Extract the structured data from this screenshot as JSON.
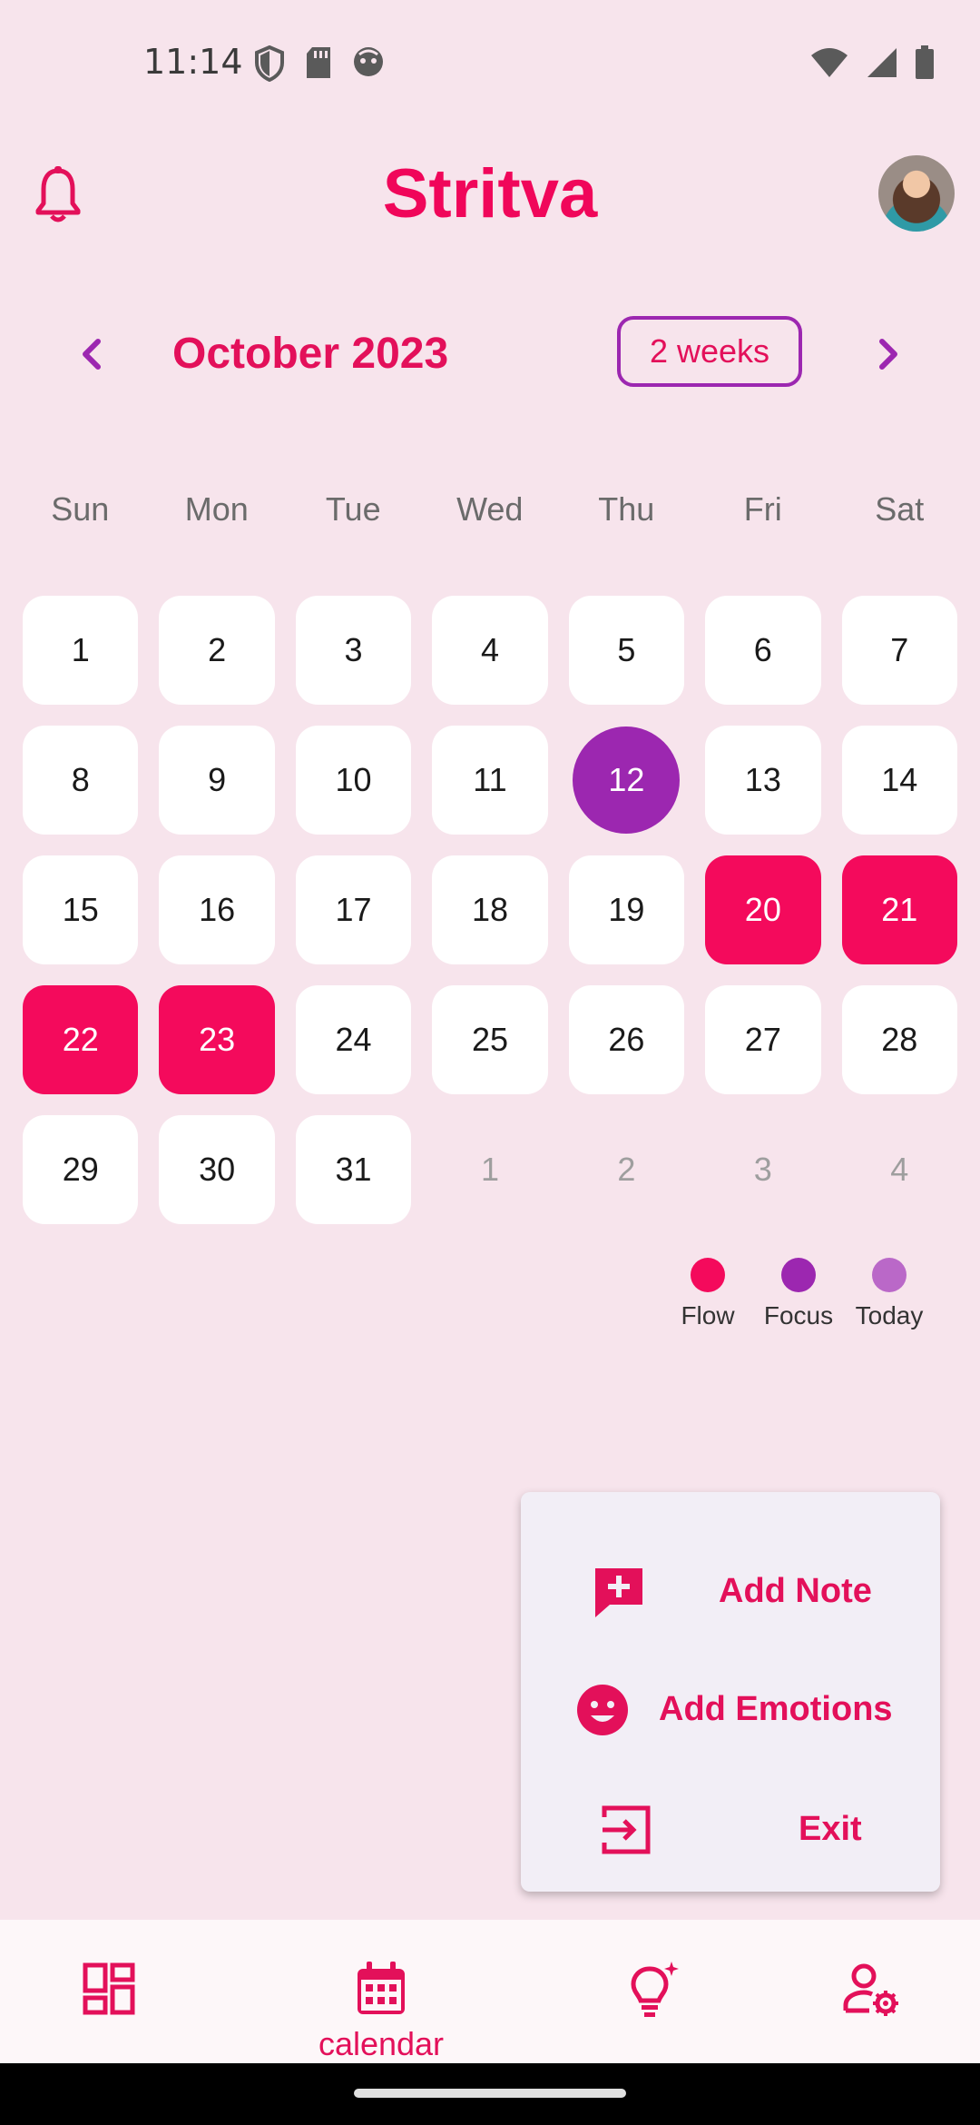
{
  "status_bar": {
    "time": "11:14"
  },
  "app": {
    "title": "Stritva"
  },
  "calendar": {
    "month_label": "October 2023",
    "range_button": "2 weeks",
    "weekdays": [
      "Sun",
      "Mon",
      "Tue",
      "Wed",
      "Thu",
      "Fri",
      "Sat"
    ],
    "weeks": [
      [
        {
          "d": "1"
        },
        {
          "d": "2"
        },
        {
          "d": "3"
        },
        {
          "d": "4"
        },
        {
          "d": "5"
        },
        {
          "d": "6"
        },
        {
          "d": "7"
        }
      ],
      [
        {
          "d": "8"
        },
        {
          "d": "9"
        },
        {
          "d": "10"
        },
        {
          "d": "11"
        },
        {
          "d": "12",
          "state": "today"
        },
        {
          "d": "13"
        },
        {
          "d": "14"
        }
      ],
      [
        {
          "d": "15"
        },
        {
          "d": "16"
        },
        {
          "d": "17"
        },
        {
          "d": "18"
        },
        {
          "d": "19"
        },
        {
          "d": "20",
          "state": "flow"
        },
        {
          "d": "21",
          "state": "flow"
        }
      ],
      [
        {
          "d": "22",
          "state": "flow"
        },
        {
          "d": "23",
          "state": "flow"
        },
        {
          "d": "24"
        },
        {
          "d": "25"
        },
        {
          "d": "26"
        },
        {
          "d": "27"
        },
        {
          "d": "28"
        }
      ],
      [
        {
          "d": "29"
        },
        {
          "d": "30"
        },
        {
          "d": "31"
        },
        {
          "d": "1",
          "state": "other"
        },
        {
          "d": "2",
          "state": "other"
        },
        {
          "d": "3",
          "state": "other"
        },
        {
          "d": "4",
          "state": "other"
        }
      ]
    ]
  },
  "legend": [
    {
      "label": "Flow",
      "color": "#f40a5c"
    },
    {
      "label": "Focus",
      "color": "#9c27b0"
    },
    {
      "label": "Today",
      "color": "#ba68c8"
    }
  ],
  "menu": {
    "add_note": "Add Note",
    "add_emotions": "Add Emotions",
    "exit": "Exit"
  },
  "bottom_nav": {
    "calendar_label": "calendar"
  },
  "colors": {
    "accent": "#e3105a",
    "flow": "#f40a5c",
    "focus": "#9c27b0",
    "today": "#ba68c8"
  }
}
